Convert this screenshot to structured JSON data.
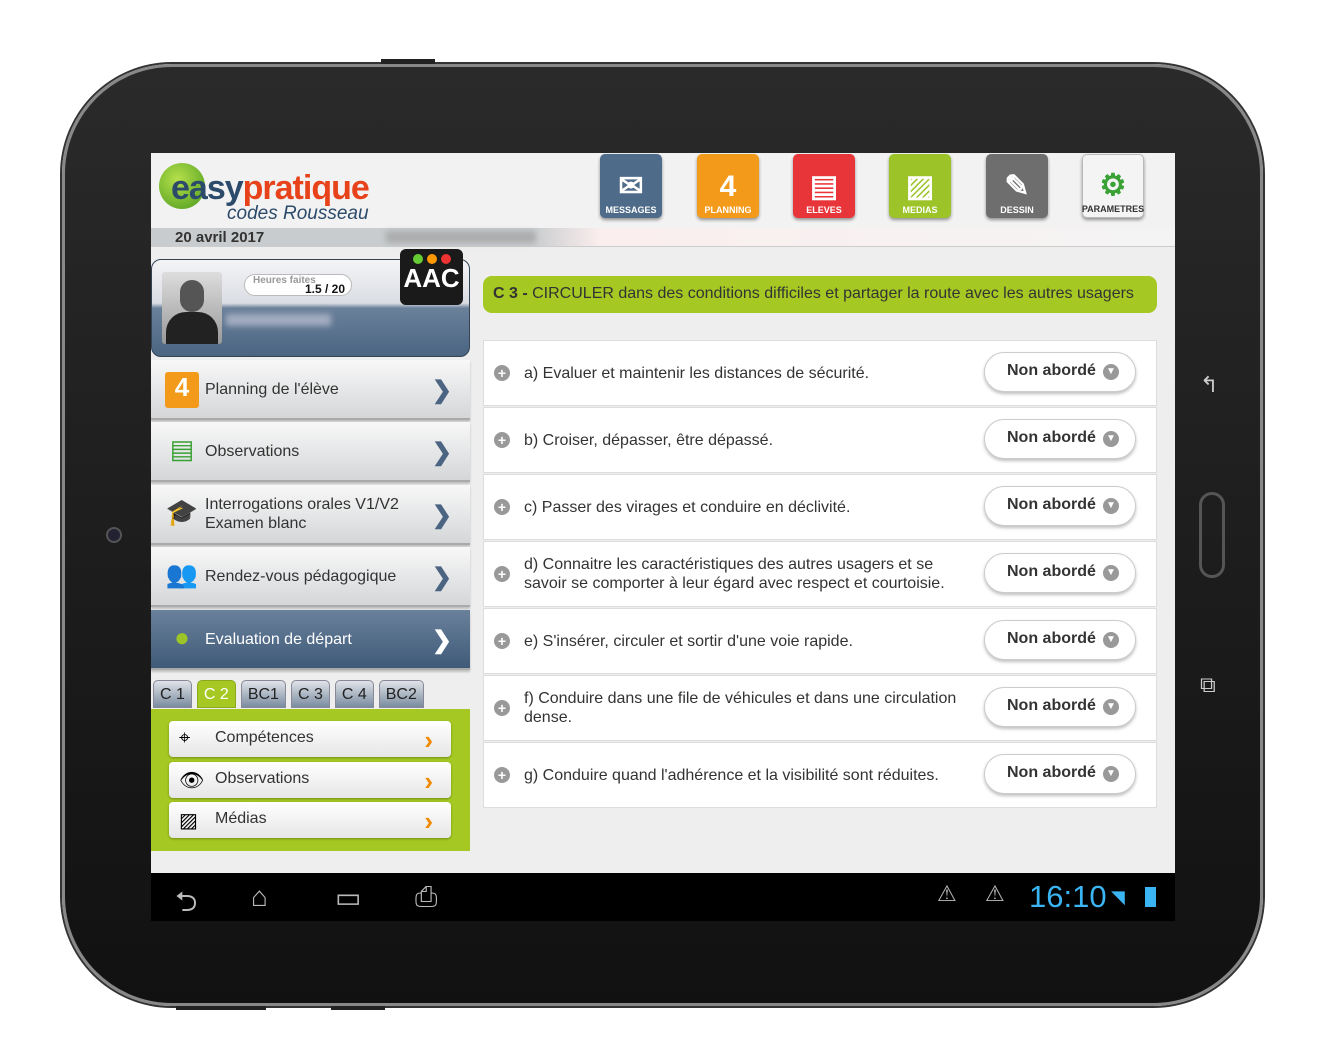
{
  "header": {
    "apps": [
      {
        "label": "MESSAGES",
        "icon": "envelope-icon",
        "color": "#4e6b8a"
      },
      {
        "label": "PLANNING",
        "icon": "calendar-icon",
        "color": "#f39a1a"
      },
      {
        "label": "ELEVES",
        "icon": "students-icon",
        "color": "#e8353a"
      },
      {
        "label": "MEDIAS",
        "icon": "image-icon",
        "color": "#9cc428"
      },
      {
        "label": "DESSIN",
        "icon": "pencil-icon",
        "color": "#6e6e6e"
      },
      {
        "label": "PARAMETRES",
        "icon": "gear-icon",
        "color": "#f4f4f4"
      }
    ],
    "logo": {
      "brand1": "easy",
      "brand2": "pratique",
      "sub": "codes Rousseau"
    }
  },
  "date": "20 avril  2017",
  "profile": {
    "hours_label": "Heures faites",
    "hours_value": "1.5 / 20",
    "badge": "AAC"
  },
  "menu": [
    {
      "label": "Planning de l'élève",
      "icon": "calendar-icon"
    },
    {
      "label": "Observations",
      "icon": "document-icon"
    },
    {
      "label": "Interrogations orales V1/V2",
      "label2": "Examen blanc",
      "icon": "graduation-icon"
    },
    {
      "label": "Rendez-vous pédagogique",
      "icon": "people-icon"
    },
    {
      "label": "Evaluation de départ",
      "icon": "user-eval-icon",
      "active": true
    }
  ],
  "tabs": [
    "C 1",
    "C 2",
    "BC1",
    "C 3",
    "C 4",
    "BC2"
  ],
  "active_tab": "C 2",
  "submenu": [
    {
      "label": "Compétences",
      "icon": "crosshair-icon"
    },
    {
      "label": "Observations",
      "icon": "eye-icon"
    },
    {
      "label": "Médias",
      "icon": "image-icon"
    }
  ],
  "section": {
    "code": "C 3 -",
    "title": "CIRCULER dans des conditions difficiles et partager la route avec les autres usagers"
  },
  "items": [
    {
      "text": "a) Evaluer et maintenir les distances de sécurité.",
      "status": "Non abordé"
    },
    {
      "text": "b) Croiser, dépasser, être dépassé.",
      "status": "Non abordé"
    },
    {
      "text": "c) Passer des virages et conduire en déclivité.",
      "status": "Non abordé"
    },
    {
      "text": "d) Connaitre les caractéristiques des autres usagers et se savoir se comporter à leur égard avec respect et courtoisie.",
      "status": "Non abordé"
    },
    {
      "text": "e) S'insérer, circuler et sortir d'une voie rapide.",
      "status": "Non abordé"
    },
    {
      "text": "f) Conduire dans une file de véhicules et dans une circulation dense.",
      "status": "Non abordé"
    },
    {
      "text": "g) Conduire quand l'adhérence et la visibilité sont réduites.",
      "status": "Non abordé"
    }
  ],
  "statusbar": {
    "time": "16:10"
  }
}
